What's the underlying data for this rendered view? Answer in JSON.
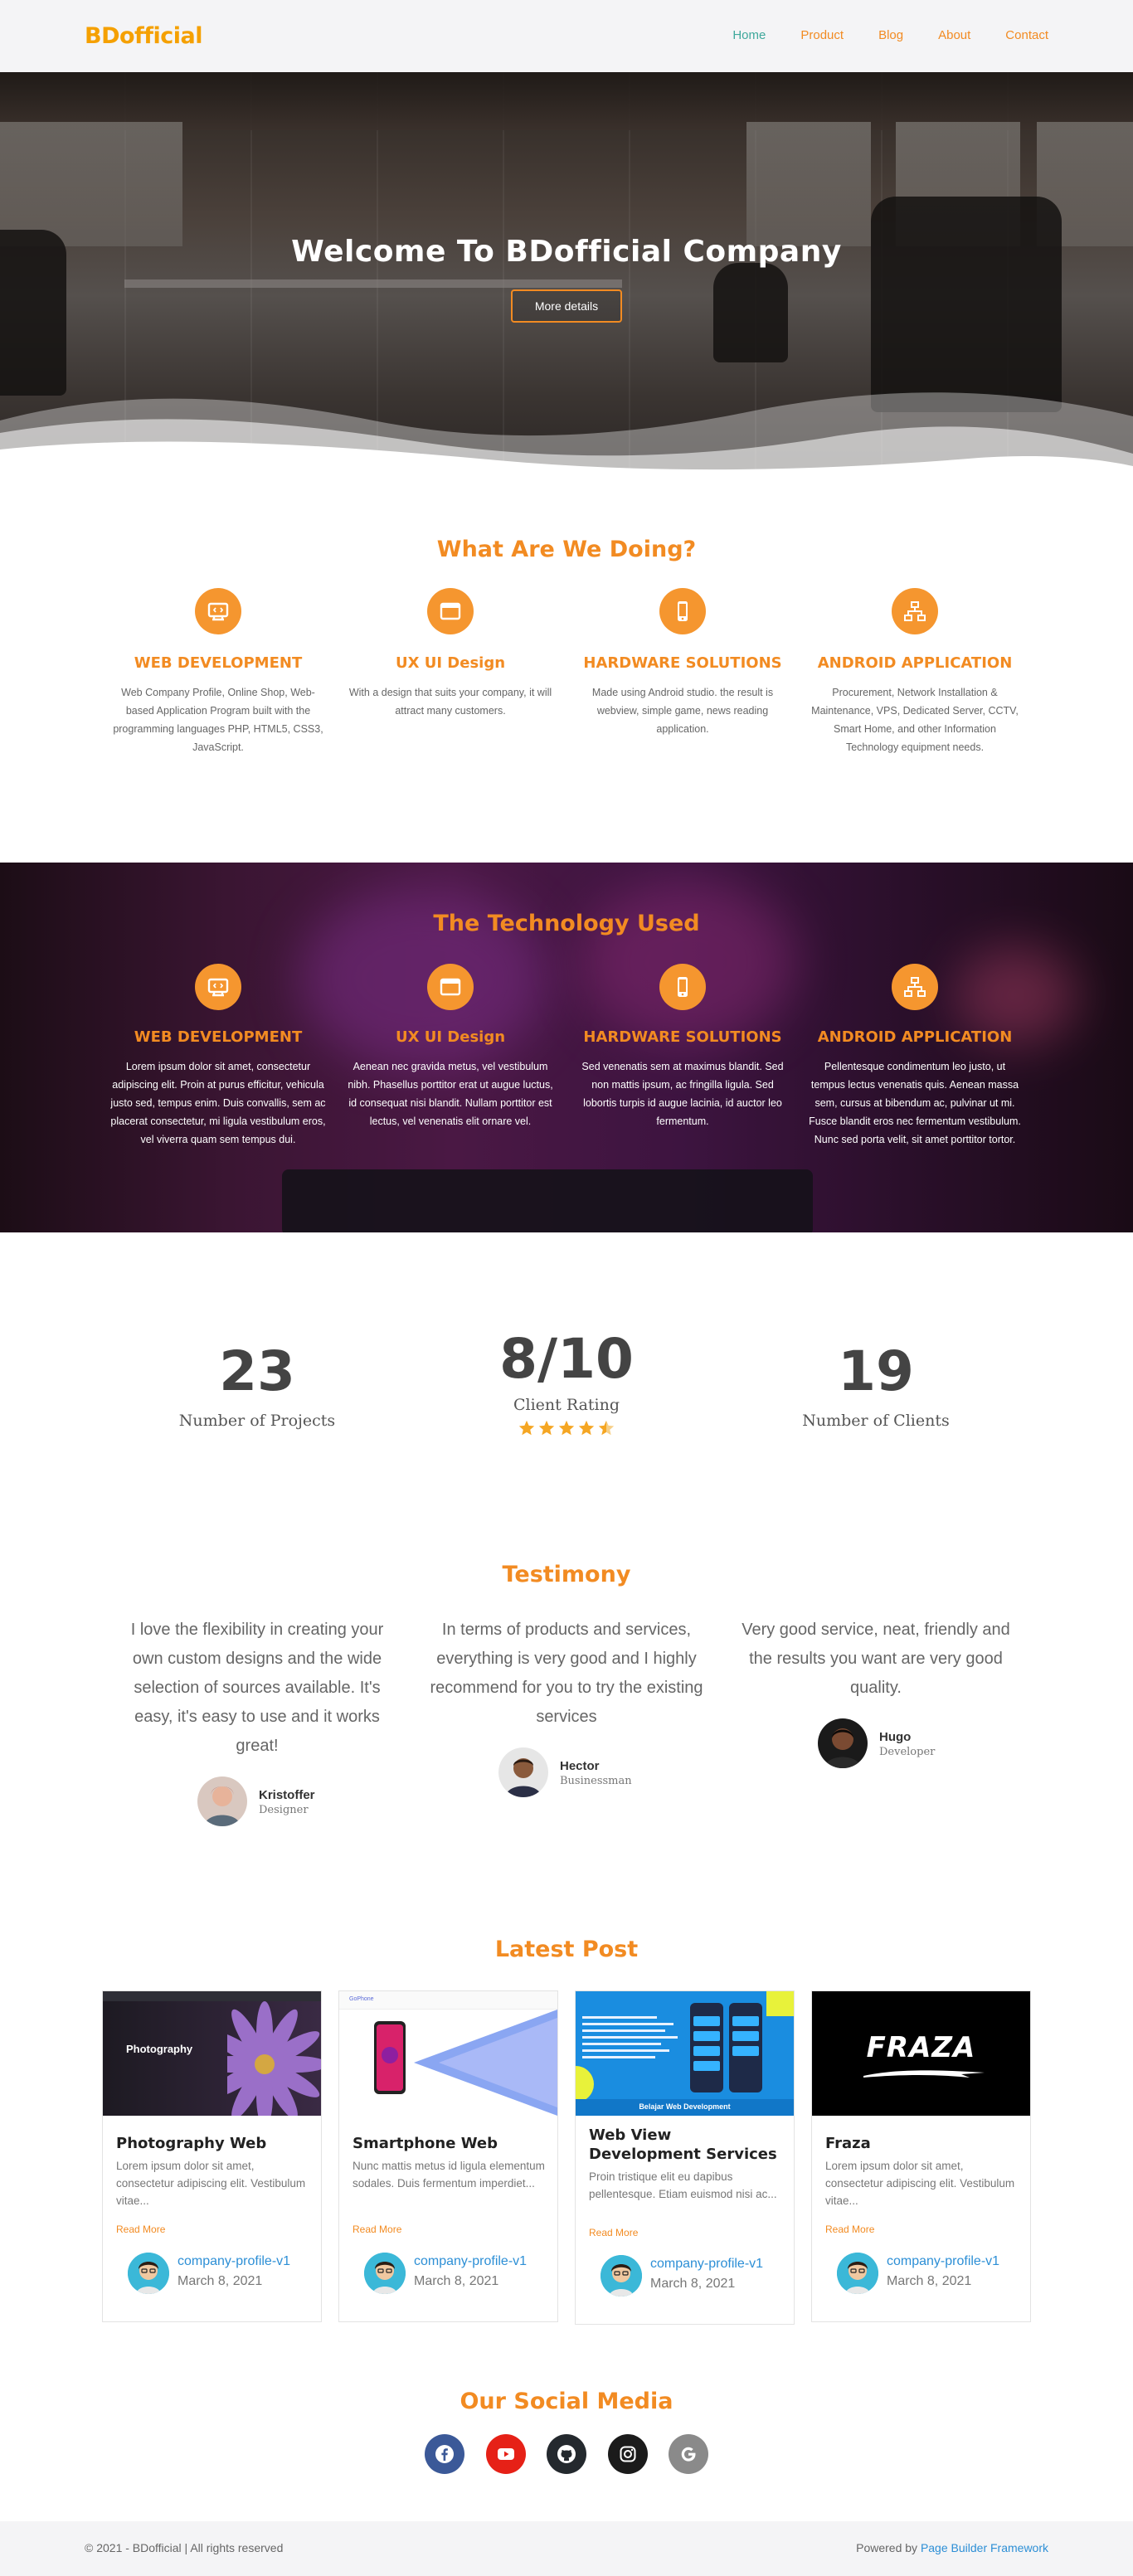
{
  "nav": {
    "brand": "BDofficial",
    "items": [
      {
        "label": "Home",
        "active": true
      },
      {
        "label": "Product"
      },
      {
        "label": "Blog"
      },
      {
        "label": "About"
      },
      {
        "label": "Contact"
      }
    ]
  },
  "hero": {
    "title": "Welcome To BDofficial Company",
    "button": "More details"
  },
  "doing": {
    "title": "What Are We Doing?",
    "items": [
      {
        "icon": "monitor-code-icon",
        "title": "WEB DEVELOPMENT",
        "text": "Web Company Profile, Online Shop, Web-based Application Program built with the programming languages PHP, HTML5, CSS3, JavaScript."
      },
      {
        "icon": "browser-window-icon",
        "title": "UX UI Design",
        "text": "With a design that suits your company, it will attract many customers."
      },
      {
        "icon": "smartphone-icon",
        "title": "HARDWARE SOLUTIONS",
        "text": "Made using Android studio. the result is webview, simple game, news reading application."
      },
      {
        "icon": "network-icon",
        "title": "ANDROID APPLICATION",
        "text": "Procurement, Network Installation & Maintenance, VPS, Dedicated Server, CCTV, Smart Home, and other Information Technology equipment needs."
      }
    ]
  },
  "tech": {
    "title": "The Technology Used",
    "items": [
      {
        "icon": "monitor-code-icon",
        "title": "WEB DEVELOPMENT",
        "text": "Lorem ipsum dolor sit amet, consectetur adipiscing elit. Proin at purus efficitur, vehicula justo sed, tempus enim. Duis convallis, sem ac placerat consectetur, mi ligula vestibulum eros, vel viverra quam sem tempus dui."
      },
      {
        "icon": "browser-window-icon",
        "title": "UX UI Design",
        "text": "Aenean nec gravida metus, vel vestibulum nibh. Phasellus porttitor erat ut augue luctus, id consequat nisi blandit. Nullam porttitor est lectus, vel venenatis elit ornare vel."
      },
      {
        "icon": "smartphone-icon",
        "title": "HARDWARE SOLUTIONS",
        "text": "Sed venenatis sem at maximus blandit. Sed non mattis ipsum, ac fringilla ligula. Sed lobortis turpis id augue lacinia, id auctor leo fermentum."
      },
      {
        "icon": "network-icon",
        "title": "ANDROID APPLICATION",
        "text": "Pellentesque condimentum leo justo, ut tempus lectus venenatis quis. Aenean massa sem, cursus at bibendum ac, pulvinar ut mi. Fusce blandit eros nec fermentum vestibulum. Nunc sed porta velit, sit amet porttitor tortor."
      }
    ]
  },
  "stats": [
    {
      "value": "23",
      "label": "Number of Projects"
    },
    {
      "value": "8/10",
      "label": "Client Rating",
      "stars": 4.5
    },
    {
      "value": "19",
      "label": "Number of Clients"
    }
  ],
  "testimony": {
    "title": "Testimony",
    "items": [
      {
        "quote": "I love the flexibility in creating your own custom designs and the wide selection of sources available. It's easy, it's easy to use and it works great!",
        "name": "Kristoffer",
        "role": "Designer"
      },
      {
        "quote": "In terms of products and services, everything is very good and I highly recommend for you to try the existing services",
        "name": "Hector",
        "role": "Businessman"
      },
      {
        "quote": "Very good service, neat, friendly and the results you want are very good quality.",
        "name": "Hugo",
        "role": "Developer"
      }
    ]
  },
  "posts": {
    "title": "Latest Post",
    "items": [
      {
        "title": "Photography Web",
        "excerpt": "Lorem ipsum dolor sit amet, consectetur adipiscing elit. Vestibulum vitae...",
        "read_more": "Read More",
        "author": "company-profile-v1",
        "date": "March 8, 2021",
        "thumb_text": "Photography"
      },
      {
        "title": "Smartphone Web",
        "excerpt": "Nunc mattis metus id ligula elementum sodales. Duis fermentum imperdiet...",
        "read_more": "Read More",
        "author": "company-profile-v1",
        "date": "March 8, 2021",
        "thumb_text": "GoPhone"
      },
      {
        "title": "Web View Development Services",
        "excerpt": "Proin tristique elit eu dapibus pellentesque. Etiam euismod nisi ac...",
        "read_more": "Read More",
        "author": "company-profile-v1",
        "date": "March 8, 2021",
        "thumb_text": "Belajar Web Development"
      },
      {
        "title": "Fraza",
        "excerpt": "Lorem ipsum dolor sit amet, consectetur adipiscing elit. Vestibulum vitae...",
        "read_more": "Read More",
        "author": "company-profile-v1",
        "date": "March 8, 2021",
        "thumb_text": "FRAZA"
      }
    ]
  },
  "social": {
    "title": "Our Social Media",
    "items": [
      {
        "icon": "facebook-icon",
        "color": "#3b5998"
      },
      {
        "icon": "youtube-icon",
        "color": "#e62117"
      },
      {
        "icon": "github-icon",
        "color": "#24292e"
      },
      {
        "icon": "instagram-icon",
        "color": "#1b1b1b"
      },
      {
        "icon": "google-icon",
        "color": "#8a8a8a"
      }
    ]
  },
  "footer": {
    "copyright": "© 2021 - BDofficial | All rights reserved",
    "powered_prefix": "Powered by ",
    "powered_link": "Page Builder Framework"
  },
  "colors": {
    "accent": "#f28b22",
    "brand": "#f5a000",
    "link": "#2d8fd6",
    "nav_active": "#3fa89c"
  }
}
